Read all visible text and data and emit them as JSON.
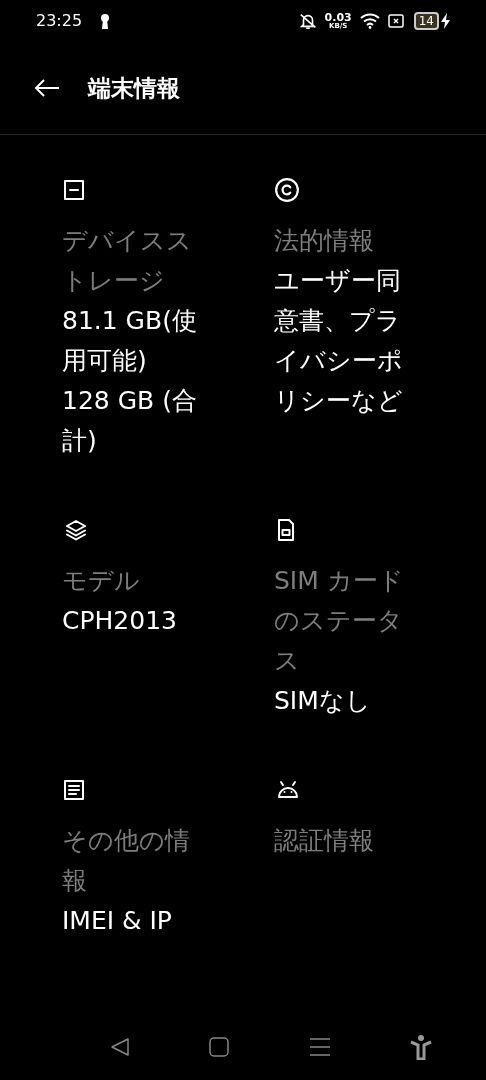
{
  "status_bar": {
    "time": "23:25",
    "speed_value": "0.03",
    "speed_unit": "KB/S",
    "battery": "14"
  },
  "header": {
    "title": "端末情報"
  },
  "items": [
    {
      "kind": "storage",
      "title": "デバイスストレージ",
      "values": [
        "81.1 GB(使用可能)",
        "128 GB (合計)"
      ]
    },
    {
      "kind": "legal",
      "title": "法的情報",
      "values": [
        "ユーザー同意書、プライバシーポリシーなど"
      ]
    },
    {
      "kind": "model",
      "title": "モデル",
      "values": [
        "CPH2013"
      ]
    },
    {
      "kind": "sim",
      "title": "SIM カードのステータス",
      "values": [
        "SIMなし"
      ]
    },
    {
      "kind": "other",
      "title": "その他の情報",
      "values": [
        "IMEI & IP"
      ]
    },
    {
      "kind": "certification",
      "title": "認証情報"
    }
  ]
}
